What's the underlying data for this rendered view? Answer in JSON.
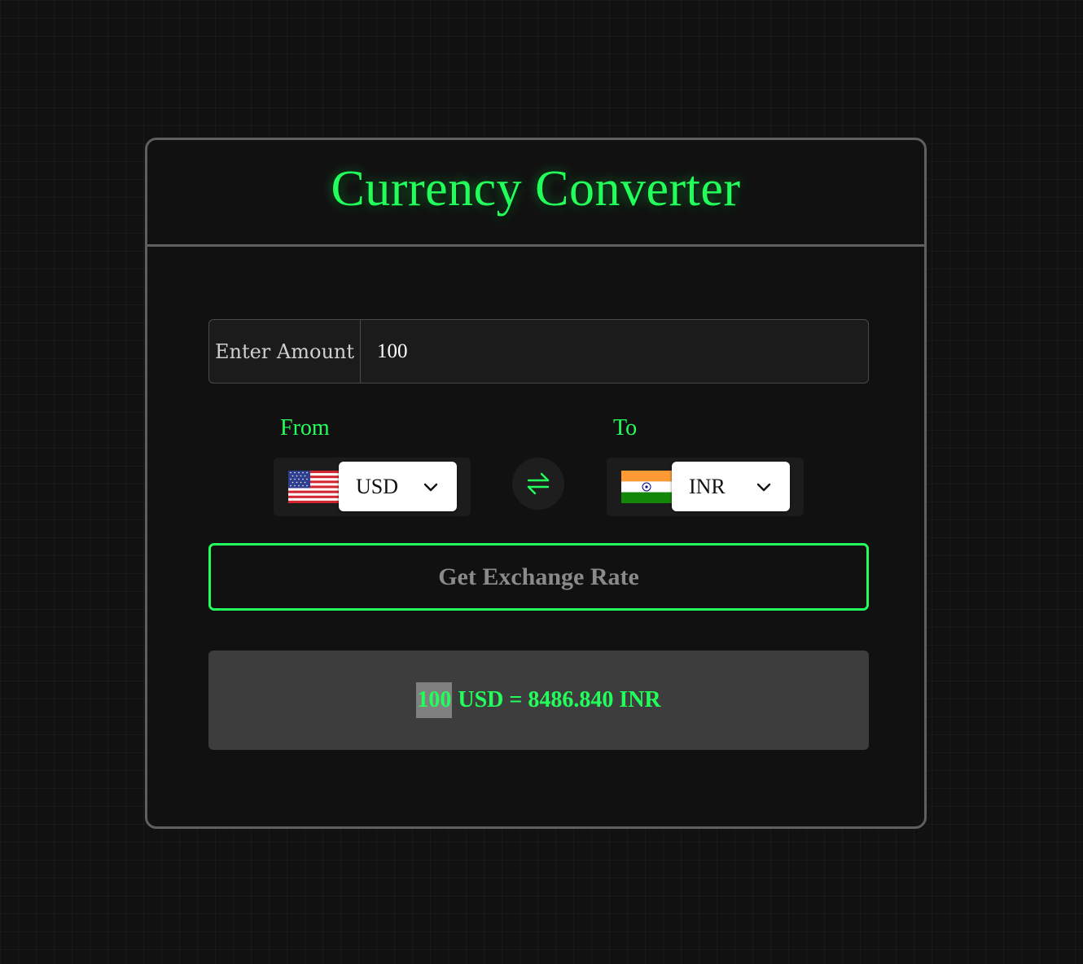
{
  "header": {
    "title": "Currency Converter"
  },
  "amount": {
    "label": "Enter Amount",
    "value": "100"
  },
  "from": {
    "label": "From",
    "currency": "USD",
    "flag": "us-flag-icon"
  },
  "to": {
    "label": "To",
    "currency": "INR",
    "flag": "india-flag-icon"
  },
  "swap": {
    "icon": "swap-arrows-icon"
  },
  "action": {
    "button_label": "Get Exchange Rate"
  },
  "result": {
    "amount": "100",
    "rest": " USD = 8486.840 INR"
  },
  "colors": {
    "accent": "#22ff5a",
    "background": "#111111",
    "border": "#5f5f5f",
    "result_bg": "#3d3d3d"
  }
}
